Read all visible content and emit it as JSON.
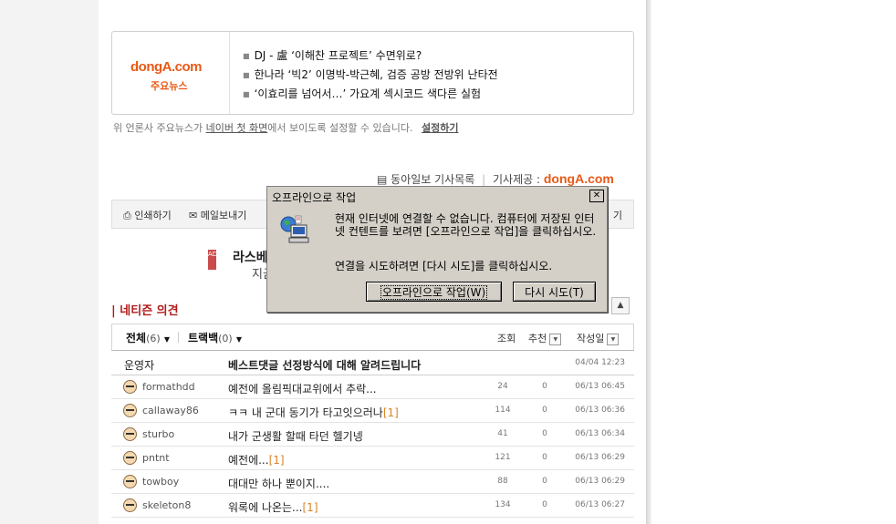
{
  "news_box": {
    "logo": "dongA.com",
    "logo_sub": "주요뉴스",
    "headlines": [
      "DJ - 盧 ‘이해찬 프로젝트’ 수면위로?",
      "한나라 ‘빅2’ 이명박-박근혜, 검증 공방 전방위 난타전",
      "‘이효리를 넘어서…’ 가요계 섹시코드 색다른 실험"
    ],
    "notice_pre": "위 언론사 주요뉴스가",
    "notice_link": "네이버 첫 화면",
    "notice_post": "에서 보이도록 설정할 수 있습니다.",
    "notice_action": "설정하기"
  },
  "article_bar": {
    "list_label": "동아일보 기사목록",
    "provider_label": "기사제공 :",
    "provider_logo": "dongA.com"
  },
  "toolbar": {
    "print": "인쇄하기",
    "mail": "메일보내기",
    "right_partial": "기"
  },
  "ad": {
    "badge": "AD",
    "title": "라스베",
    "sub": "지금"
  },
  "comments": {
    "section_title": "네티즌 의견",
    "up_icon": "▲",
    "tab_all_label": "전체",
    "tab_all_count": "(6)",
    "tab_all_arrow": "▼",
    "tab_trackback_label": "트랙백",
    "tab_trackback_count": "(0)",
    "tab_trackback_arrow": "▼",
    "col_views": "조회",
    "col_recommend": "추천",
    "col_date": "작성일",
    "sort_arrow": "▼",
    "operator": {
      "user": "운영자",
      "title": "베스트댓글 선정방식에 대해 알려드립니다",
      "date": "04/04 12:23"
    },
    "rows": [
      {
        "user": "formathdd",
        "title": "예전에 올림픽대교위에서 추락...",
        "count": "",
        "views": "24",
        "recs": "0",
        "date": "06/13 06:45"
      },
      {
        "user": "callaway86",
        "title": "ㅋㅋ 내 군대 동기가 타고잇으러나",
        "count": "[1]",
        "views": "114",
        "recs": "0",
        "date": "06/13 06:36"
      },
      {
        "user": "sturbo",
        "title": "내가 군생활 할때 타던 헬기넹",
        "count": "",
        "views": "41",
        "recs": "0",
        "date": "06/13 06:34"
      },
      {
        "user": "pntnt",
        "title": "예전에...",
        "count": "[1]",
        "views": "121",
        "recs": "0",
        "date": "06/13 06:29"
      },
      {
        "user": "towboy",
        "title": "대대만 하나 뿐이지....",
        "count": "",
        "views": "88",
        "recs": "0",
        "date": "06/13 06:29"
      },
      {
        "user": "skeleton8",
        "title": "워록에 나온는...",
        "count": "[1]",
        "views": "134",
        "recs": "0",
        "date": "06/13 06:27"
      }
    ]
  },
  "dialog": {
    "title": "오프라인으로 작업",
    "close": "✕",
    "message1": "현재 인터넷에 연결할 수 없습니다. 컴퓨터에 저장된 인터넷 컨텐트를 보려면 [오프라인으로 작업]을 클릭하십시오.",
    "message2": "연결을 시도하려면 [다시 시도]를 클릭하십시오.",
    "btn_offline": "오프라인으로 작업(W)",
    "btn_retry": "다시 시도(T)"
  }
}
